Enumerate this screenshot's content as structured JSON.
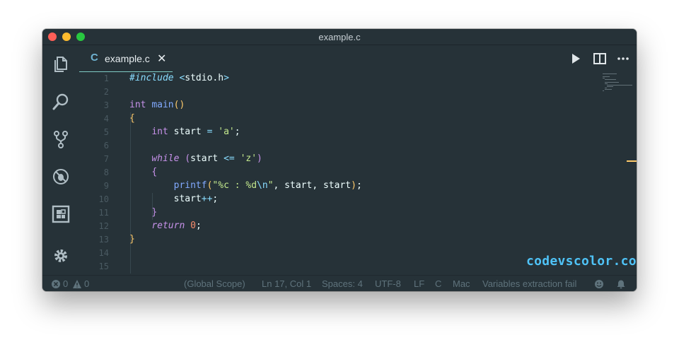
{
  "window": {
    "title": "example.c"
  },
  "tab": {
    "lang_glyph": "C",
    "name": "example.c",
    "close_glyph": "✕"
  },
  "editor_actions": [
    "play-icon",
    "split-editor-icon",
    "more-icon"
  ],
  "activity_bar": [
    "explorer-icon",
    "search-icon",
    "source-control-icon",
    "debug-icon",
    "extensions-icon",
    "settings-icon"
  ],
  "code": {
    "lines": [
      {
        "n": "1",
        "text": "#include <stdio.h>"
      },
      {
        "n": "2",
        "text": ""
      },
      {
        "n": "3",
        "text": "int main()"
      },
      {
        "n": "4",
        "text": "{"
      },
      {
        "n": "5",
        "text": "    int start = 'a';"
      },
      {
        "n": "6",
        "text": ""
      },
      {
        "n": "7",
        "text": "    while (start <= 'z')"
      },
      {
        "n": "8",
        "text": "    {"
      },
      {
        "n": "9",
        "text": "        printf(\"%c : %d\\n\", start, start);"
      },
      {
        "n": "10",
        "text": "        start++;"
      },
      {
        "n": "11",
        "text": "    }"
      },
      {
        "n": "12",
        "text": "    return 0;"
      },
      {
        "n": "13",
        "text": "}"
      },
      {
        "n": "14",
        "text": ""
      },
      {
        "n": "15",
        "text": ""
      }
    ]
  },
  "watermark": "codevscolor.com",
  "status": {
    "errors": "0",
    "warnings": "0",
    "scope": "(Global Scope)",
    "position": "Ln 17, Col 1",
    "spaces": "Spaces: 4",
    "encoding": "UTF-8",
    "eol": "LF",
    "language": "C",
    "platform": "Mac",
    "message": "Variables extraction fail"
  },
  "colors": {
    "background": "#263238",
    "accent": "#80cbc4",
    "keyword": "#c792ea",
    "function": "#82aaff",
    "string": "#c3e88d",
    "number": "#f78c6c",
    "bracket": "#ffcb6b"
  }
}
